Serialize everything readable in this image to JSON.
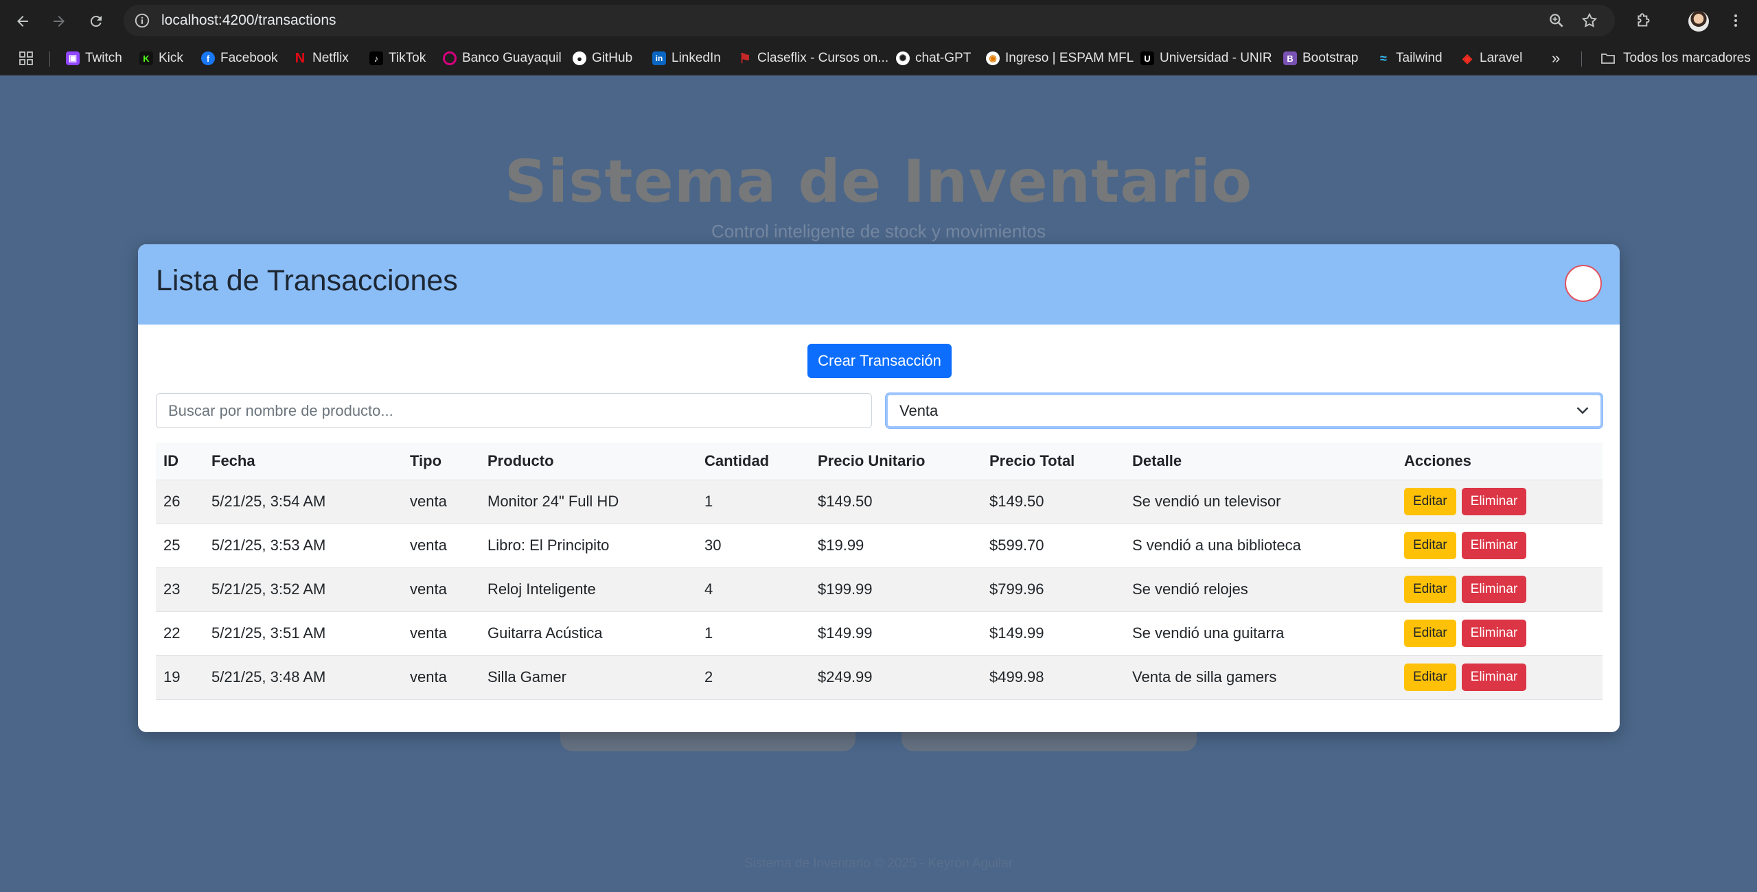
{
  "browser": {
    "url": "localhost:4200/transactions",
    "bookmarks": [
      {
        "label": "Twitch",
        "icon": "twitch-icon",
        "color": "#9146ff"
      },
      {
        "label": "Kick",
        "icon": "kick-icon",
        "color": "#53fc18"
      },
      {
        "label": "Facebook",
        "icon": "facebook-icon",
        "color": "#1877f2"
      },
      {
        "label": "Netflix",
        "icon": "netflix-icon",
        "color": "#e50914"
      },
      {
        "label": "TikTok",
        "icon": "tiktok-icon",
        "color": "#010101"
      },
      {
        "label": "Banco Guayaquil",
        "icon": "banco-guayaquil-icon",
        "color": "#d6007e"
      },
      {
        "label": "GitHub",
        "icon": "github-icon",
        "color": "#ffffff"
      },
      {
        "label": "LinkedIn",
        "icon": "linkedin-icon",
        "color": "#0a66c2"
      },
      {
        "label": "Claseflix - Cursos on...",
        "icon": "claseflix-icon",
        "color": "#c62828"
      },
      {
        "label": "chat-GPT",
        "icon": "chatgpt-icon",
        "color": "#ffffff"
      },
      {
        "label": "Ingreso | ESPAM MFL",
        "icon": "espam-icon",
        "color": "#e07b00"
      },
      {
        "label": "Universidad - UNIR",
        "icon": "unir-icon",
        "color": "#000000"
      },
      {
        "label": "Bootstrap",
        "icon": "bootstrap-icon",
        "color": "#7952b3"
      },
      {
        "label": "Tailwind",
        "icon": "tailwind-icon",
        "color": "#38bdf8"
      },
      {
        "label": "Laravel",
        "icon": "laravel-icon",
        "color": "#ff2d20"
      }
    ],
    "all_bookmarks_label": "Todos los marcadores"
  },
  "background_page": {
    "title": "Sistema de Inventario",
    "subtitle": "Control inteligente de stock y movimientos",
    "footer": "Sistema de Inventario © 2025 - Keyron Aguilar"
  },
  "modal": {
    "title": "Lista de Transacciones",
    "create_button": "Crear Transacción",
    "search_placeholder": "Buscar por nombre de producto...",
    "filter_value": "Venta",
    "columns": [
      "ID",
      "Fecha",
      "Tipo",
      "Producto",
      "Cantidad",
      "Precio Unitario",
      "Precio Total",
      "Detalle",
      "Acciones"
    ],
    "edit_label": "Editar",
    "delete_label": "Eliminar",
    "rows": [
      {
        "id": "26",
        "fecha": "5/21/25, 3:54 AM",
        "tipo": "venta",
        "producto": "Monitor 24\" Full HD",
        "cantidad": "1",
        "precio_unitario": "$149.50",
        "precio_total": "$149.50",
        "detalle": "Se vendió un televisor"
      },
      {
        "id": "25",
        "fecha": "5/21/25, 3:53 AM",
        "tipo": "venta",
        "producto": "Libro: El Principito",
        "cantidad": "30",
        "precio_unitario": "$19.99",
        "precio_total": "$599.70",
        "detalle": "S vendió a una biblioteca"
      },
      {
        "id": "23",
        "fecha": "5/21/25, 3:52 AM",
        "tipo": "venta",
        "producto": "Reloj Inteligente",
        "cantidad": "4",
        "precio_unitario": "$199.99",
        "precio_total": "$799.96",
        "detalle": "Se vendió relojes"
      },
      {
        "id": "22",
        "fecha": "5/21/25, 3:51 AM",
        "tipo": "venta",
        "producto": "Guitarra Acústica",
        "cantidad": "1",
        "precio_unitario": "$149.99",
        "precio_total": "$149.99",
        "detalle": "Se vendió una guitarra"
      },
      {
        "id": "19",
        "fecha": "5/21/25, 3:48 AM",
        "tipo": "venta",
        "producto": "Silla Gamer",
        "cantidad": "2",
        "precio_unitario": "$249.99",
        "precio_total": "$499.98",
        "detalle": "Venta de silla gamers"
      }
    ]
  },
  "colors": {
    "modal_header": "#8bbdf6",
    "primary": "#0d6efd",
    "warning": "#ffc107",
    "danger": "#dc3545",
    "page_bg": "#4f6a8e"
  }
}
